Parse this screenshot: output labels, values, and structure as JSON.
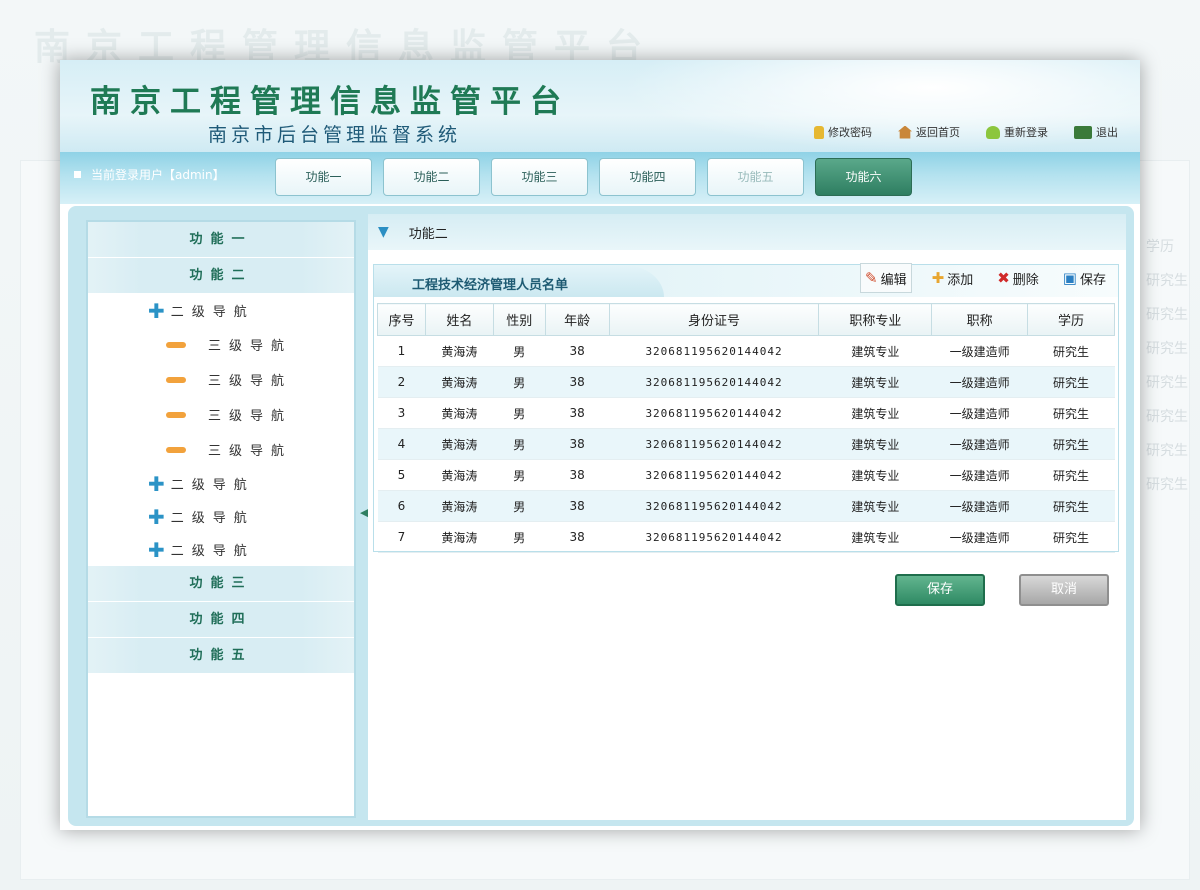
{
  "app": {
    "title": "南京工程管理信息监管平台",
    "subtitle": "南京市后台管理监督系统"
  },
  "top_links": [
    {
      "label": "修改密码",
      "icon": "lock-icon"
    },
    {
      "label": "返回首页",
      "icon": "home-icon"
    },
    {
      "label": "重新登录",
      "icon": "user-icon"
    },
    {
      "label": "退出",
      "icon": "exit-icon"
    }
  ],
  "user": {
    "label": "当前登录用户【admin】"
  },
  "tabs": [
    "功能一",
    "功能二",
    "功能三",
    "功能四",
    "功能五",
    "功能六"
  ],
  "sidebar": {
    "sections": [
      "功能一",
      "功能二",
      "功能三",
      "功能四",
      "功能五"
    ],
    "l2": [
      "二级导航",
      "二级导航",
      "二级导航",
      "二级导航"
    ],
    "l3": [
      "三级导航",
      "三级导航",
      "三级导航",
      "三级导航"
    ]
  },
  "breadcrumb": "功能二",
  "list": {
    "title": "工程技术经济管理人员名单",
    "tools": {
      "edit": "编辑",
      "add": "添加",
      "delete": "删除",
      "save": "保存"
    },
    "columns": [
      "序号",
      "姓名",
      "性别",
      "年龄",
      "身份证号",
      "职称专业",
      "职称",
      "学历"
    ],
    "rows": [
      [
        "1",
        "黄海涛",
        "男",
        "38",
        "320681195620144042",
        "建筑专业",
        "一级建造师",
        "研究生"
      ],
      [
        "2",
        "黄海涛",
        "男",
        "38",
        "320681195620144042",
        "建筑专业",
        "一级建造师",
        "研究生"
      ],
      [
        "3",
        "黄海涛",
        "男",
        "38",
        "320681195620144042",
        "建筑专业",
        "一级建造师",
        "研究生"
      ],
      [
        "4",
        "黄海涛",
        "男",
        "38",
        "320681195620144042",
        "建筑专业",
        "一级建造师",
        "研究生"
      ],
      [
        "5",
        "黄海涛",
        "男",
        "38",
        "320681195620144042",
        "建筑专业",
        "一级建造师",
        "研究生"
      ],
      [
        "6",
        "黄海涛",
        "男",
        "38",
        "320681195620144042",
        "建筑专业",
        "一级建造师",
        "研究生"
      ],
      [
        "7",
        "黄海涛",
        "男",
        "38",
        "320681195620144042",
        "建筑专业",
        "一级建造师",
        "研究生"
      ]
    ]
  },
  "buttons": {
    "save": "保存",
    "cancel": "取消"
  },
  "background": {
    "title": "南京工程管理信息监管平台",
    "col_header": "学历",
    "col_values": [
      "研究生",
      "研究生",
      "研究生",
      "研究生",
      "研究生",
      "研究生",
      "研究生"
    ]
  },
  "colors": {
    "accent": "#2f8a64",
    "title": "#1f7a55",
    "nav": "#8fd2e6"
  }
}
